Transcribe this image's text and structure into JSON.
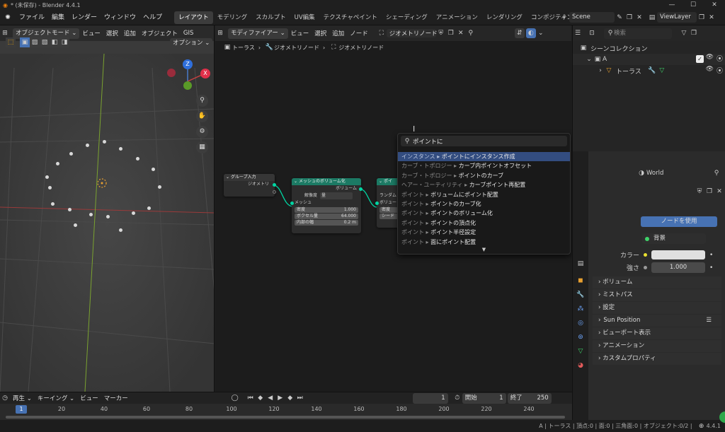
{
  "window": {
    "title": "* (未保存) - Blender 4.4.1",
    "min": "—",
    "max": "☐",
    "close": "✕"
  },
  "menu": {
    "items": [
      "ファイル",
      "編集",
      "レンダー",
      "ウィンドウ",
      "ヘルプ"
    ]
  },
  "workspaces": [
    "レイアウト",
    "モデリング",
    "スカルプト",
    "UV編集",
    "テクスチャペイント",
    "シェーディング",
    "アニメーション",
    "レンダリング",
    "コンポジティング"
  ],
  "scene": {
    "name": "Scene",
    "view_layer": "ViewLayer"
  },
  "viewport": {
    "mode": "オブジェクトモード",
    "menus": [
      "ビュー",
      "選択",
      "追加",
      "オブジェクト",
      "GIS"
    ],
    "options": "オプション",
    "gizmo": {
      "x": "X",
      "y": "Y",
      "z": "Z"
    }
  },
  "node_editor": {
    "type": "モディファイアー",
    "menus": [
      "ビュー",
      "選択",
      "追加",
      "ノード"
    ],
    "tree_name": "ジオメトリノード",
    "breadcrumb": [
      "トーラス",
      "ジオメトリノード",
      "ジオメトリノード"
    ],
    "nodes": {
      "group_input": {
        "title": "グループ入力",
        "out": "ジオメトリ"
      },
      "mesh_to_volume": {
        "title": "メッシュのボリューム化",
        "out": "ボリューム",
        "res_label": "解像度",
        "res_value": "量",
        "in_mesh": "メッシュ",
        "f1_label": "密度",
        "f1_value": "1.000",
        "f2_label": "ボクセル量",
        "f2_value": "64.000",
        "f3_label": "内部の幅",
        "f3_value": "0.2 m"
      },
      "distribute": {
        "title": "ポイ",
        "r1": "ランダム",
        "r2": "ボリュー",
        "r3": "密度",
        "r4": "シード"
      }
    }
  },
  "search": {
    "query": "ポイントに",
    "results": [
      {
        "category": "インスタンス",
        "name": "ポイントにインスタンス作成"
      },
      {
        "category": "カーブ・トポロジー",
        "name": "カーブ内ポイントオフセット"
      },
      {
        "category": "カーブ・トポロジー",
        "name": "ポイントのカーブ"
      },
      {
        "category": "ヘアー・ユーティリティ",
        "name": "カーブポイント再配置"
      },
      {
        "category": "ポイント",
        "name": "ボリュームにポイント配置"
      },
      {
        "category": "ポイント",
        "name": "ポイントのカーブ化"
      },
      {
        "category": "ポイント",
        "name": "ポイントのボリューム化"
      },
      {
        "category": "ポイント",
        "name": "ポイントの頂点化"
      },
      {
        "category": "ポイント",
        "name": "ポイント半径設定"
      },
      {
        "category": "ポイント",
        "name": "面にポイント配置"
      }
    ],
    "separator": " ▸ ",
    "more": "▼"
  },
  "outliner": {
    "search_placeholder": "検索",
    "scene_collection": "シーンコレクション",
    "collection": "A",
    "object": "トーラス"
  },
  "properties": {
    "world": "World",
    "use_nodes": "ノードを使用",
    "surface": "背景",
    "color_label": "カラー",
    "strength_label": "強さ",
    "strength": "1.000",
    "panels": [
      "ボリューム",
      "ミストパス",
      "設定",
      "Sun Position",
      "ビューポート表示",
      "アニメーション",
      "カスタムプロパティ"
    ]
  },
  "timeline": {
    "playback": "再生",
    "keying": "キーイング",
    "view": "ビュー",
    "marker": "マーカー",
    "current": "1",
    "start_label": "開始",
    "start": "1",
    "end_label": "終了",
    "end": "250",
    "ticks": [
      "1",
      "20",
      "40",
      "60",
      "80",
      "100",
      "120",
      "140",
      "160",
      "180",
      "200",
      "220",
      "240"
    ]
  },
  "status": {
    "text": "A | トーラス | 頂点:0 | 面:0 | 三角面:0 | オブジェクト:0/2 |",
    "version": "4.4.1"
  }
}
